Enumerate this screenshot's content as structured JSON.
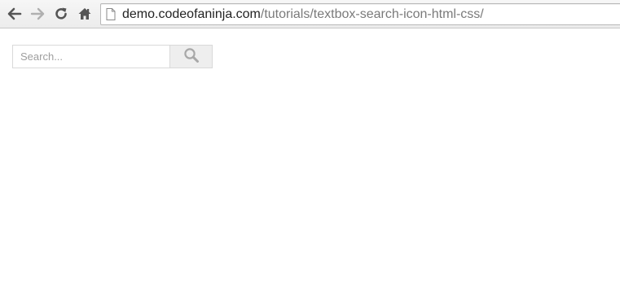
{
  "browser": {
    "url_domain": "demo.codeofaninja.com",
    "url_path": "/tutorials/textbox-search-icon-html-css/",
    "icons": {
      "back": "back-arrow-icon",
      "forward": "forward-arrow-icon",
      "reload": "reload-icon",
      "home": "home-icon",
      "page": "page-icon"
    }
  },
  "search": {
    "placeholder": "Search...",
    "value": "",
    "button_icon": "magnifier-icon"
  },
  "colors": {
    "toolbar": "#ececec",
    "icon_dark": "#555555",
    "icon_disabled": "#b0b0b0",
    "search_border": "#d9d9d9",
    "search_button_bg": "#eeeeee",
    "magnifier": "#a8a8a8"
  }
}
